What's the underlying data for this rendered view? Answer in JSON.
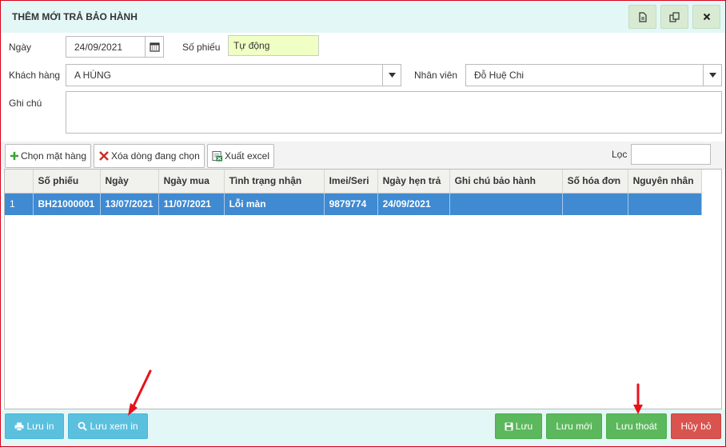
{
  "dialog": {
    "title": "THÊM MỚI TRẢ BẢO HÀNH",
    "toolbar_icons": [
      "document-icon",
      "copy-icon",
      "close-icon"
    ]
  },
  "form": {
    "date_label": "Ngày",
    "date_value": "24/09/2021",
    "voucher_label": "Số phiếu",
    "voucher_value": "Tự động",
    "customer_label": "Khách hàng",
    "customer_value": "A HÙNG",
    "staff_label": "Nhân viên",
    "staff_value": "Đỗ Huệ Chi",
    "note_label": "Ghi chú",
    "note_value": ""
  },
  "toolbar": {
    "choose_items": "Chọn mặt hàng",
    "delete_selected": "Xóa dòng đang chọn",
    "export_excel": "Xuất excel",
    "filter_label": "Lọc",
    "filter_value": ""
  },
  "table": {
    "columns": [
      "",
      "Số phiếu",
      "Ngày",
      "Ngày mua",
      "Tình trạng nhận",
      "Imei/Seri",
      "Ngày hẹn trả",
      "Ghi chú bảo hành",
      "Số hóa đơn",
      "Nguyên nhân"
    ],
    "rows": [
      [
        "1",
        "BH21000001",
        "13/07/2021",
        "11/07/2021",
        "Lỗi màn",
        "9879774",
        "24/09/2021",
        "",
        "",
        ""
      ]
    ]
  },
  "footer": {
    "save_print": "Lưu in",
    "save_view_print": "Lưu xem in",
    "save": "Lưu",
    "save_new": "Lưu mới",
    "save_exit": "Lưu thoát",
    "cancel": "Hủy bỏ"
  },
  "colors": {
    "selected_row": "#3f8ad1",
    "title_bg": "#e4f7f7",
    "annotation_arrow": "#e8101a"
  }
}
